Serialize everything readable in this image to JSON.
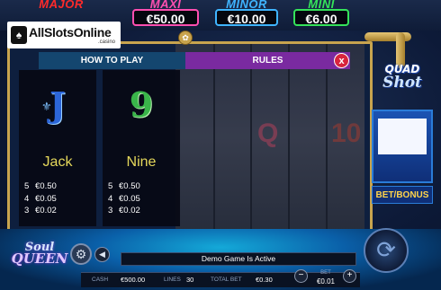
{
  "jackpots": {
    "major": {
      "name": "MAJOR",
      "value": ""
    },
    "maxi": {
      "name": "MAXI",
      "value": "€50.00"
    },
    "minor": {
      "name": "MINOR",
      "value": "€10.00"
    },
    "mini": {
      "name": "MINI",
      "value": "€6.00"
    }
  },
  "logo": {
    "text": "AllSlotsOnline",
    "sub": ".casino"
  },
  "help": {
    "tab_how_to_play": "HOW TO PLAY",
    "tab_rules": "RULES",
    "close": "x",
    "cards": [
      {
        "symbol": "J",
        "name": "Jack",
        "pays": [
          {
            "n": "5",
            "v": "€0.50"
          },
          {
            "n": "4",
            "v": "€0.05"
          },
          {
            "n": "3",
            "v": "€0.02"
          }
        ]
      },
      {
        "symbol": "9",
        "name": "Nine",
        "pays": [
          {
            "n": "5",
            "v": "€0.50"
          },
          {
            "n": "4",
            "v": "€0.05"
          },
          {
            "n": "3",
            "v": "€0.02"
          }
        ]
      }
    ]
  },
  "side": {
    "title1": "QUAD",
    "title2": "Shot",
    "bet_bonus": "BET/BONUS"
  },
  "game_logo": {
    "line1": "Soul",
    "line2": "QUEEN"
  },
  "status_text": "Demo Game Is Active",
  "footer": {
    "cash_label": "CASH",
    "cash_value": "€500.00",
    "lines_label": "LINES",
    "lines_value": "30",
    "total_bet_label": "TOTAL BET",
    "total_bet_value": "€0.30",
    "bet_label": "BET",
    "bet_value": "€0.01"
  },
  "icons": {
    "settings": "gear-icon",
    "sound": "speaker-icon",
    "spin": "spin-arrows-icon"
  }
}
